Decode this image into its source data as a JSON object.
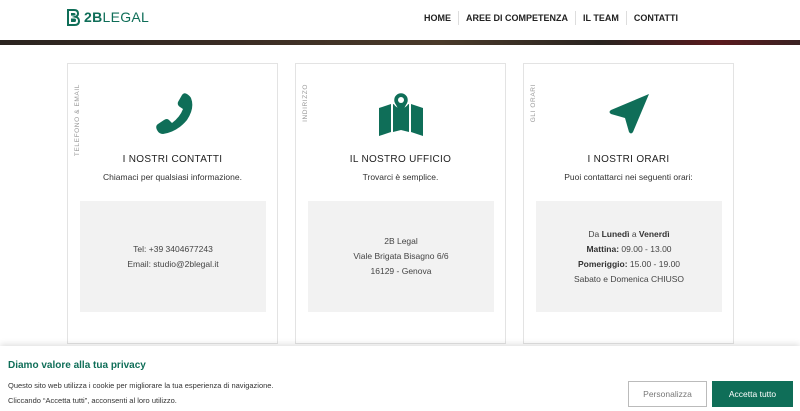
{
  "brand": {
    "name_bold": "2B",
    "name_light": "LEGAL",
    "color": "#0f6e58"
  },
  "nav": {
    "items": [
      "HOME",
      "AREE DI COMPETENZA",
      "IL TEAM",
      "CONTATTI"
    ]
  },
  "cards": [
    {
      "side_label": "TELEFONO & EMAIL",
      "icon": "phone-icon",
      "title": "I NOSTRI CONTATTI",
      "subtitle": "Chiamaci per qualsiasi informazione.",
      "lines": [
        "Tel: +39 3404677243",
        "Email: studio@2blegal.it"
      ]
    },
    {
      "side_label": "INDIRIZZO",
      "icon": "map-pin-icon",
      "title": "IL NOSTRO UFFICIO",
      "subtitle": "Trovarci è semplice.",
      "lines": [
        "2B Legal",
        "Viale Brigata Bisagno 6/6",
        "16129 - Genova"
      ]
    },
    {
      "side_label": "GLI ORARI",
      "icon": "navigation-arrow-icon",
      "title": "I NOSTRI ORARI",
      "subtitle": "Puoi contattarci nei seguenti orari:",
      "hours": {
        "days_prefix": "Da ",
        "day_from": "Lunedì",
        "days_mid": " a ",
        "day_to": "Venerdì",
        "morning_label": "Mattina:",
        "morning_value": " 09.00 - 13.00",
        "afternoon_label": "Pomeriggio:",
        "afternoon_value": " 15.00 - 19.00",
        "weekend": "Sabato e Domenica CHIUSO"
      }
    }
  ],
  "privacy": {
    "title": "Diamo valore alla tua privacy",
    "text_line1": "Questo sito web utilizza i cookie per migliorare la tua esperienza di navigazione.",
    "text_line2": "Cliccando “Accetta tutti”, acconsenti al loro utilizzo.",
    "btn_customize": "Personalizza",
    "btn_accept": "Accetta tutto"
  }
}
